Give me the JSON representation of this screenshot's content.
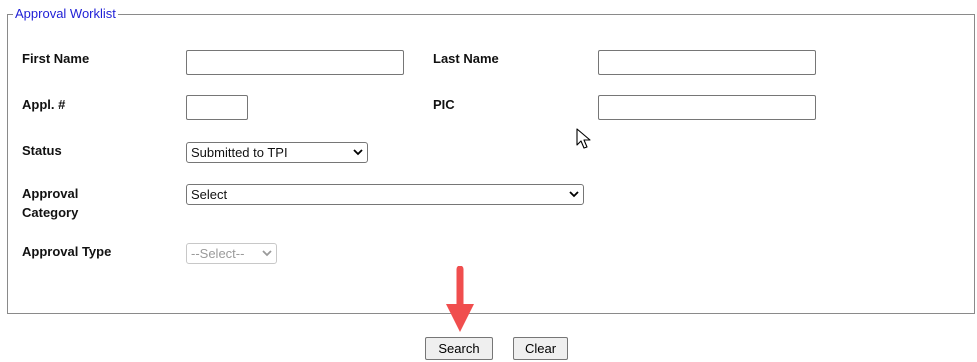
{
  "worklist": {
    "legend": "Approval Worklist",
    "first_name": {
      "label": "First Name",
      "value": ""
    },
    "last_name": {
      "label": "Last Name",
      "value": ""
    },
    "appl_no": {
      "label": "Appl. #",
      "value": ""
    },
    "pic": {
      "label": "PIC",
      "value": ""
    },
    "status": {
      "label": "Status",
      "selected": "Submitted to TPI"
    },
    "approval_category": {
      "label_line1": "Approval",
      "label_line2": "Category",
      "selected": "Select"
    },
    "approval_type": {
      "label": "Approval Type",
      "selected": "--Select--",
      "disabled": true
    }
  },
  "actions": {
    "search_label": "Search",
    "clear_label": "Clear"
  },
  "colors": {
    "legend": "#1f1fd6",
    "annotation_arrow": "#f04e4e"
  },
  "icons": {
    "annotation": "red-down-arrow",
    "cursor": "mouse-pointer-icon"
  }
}
